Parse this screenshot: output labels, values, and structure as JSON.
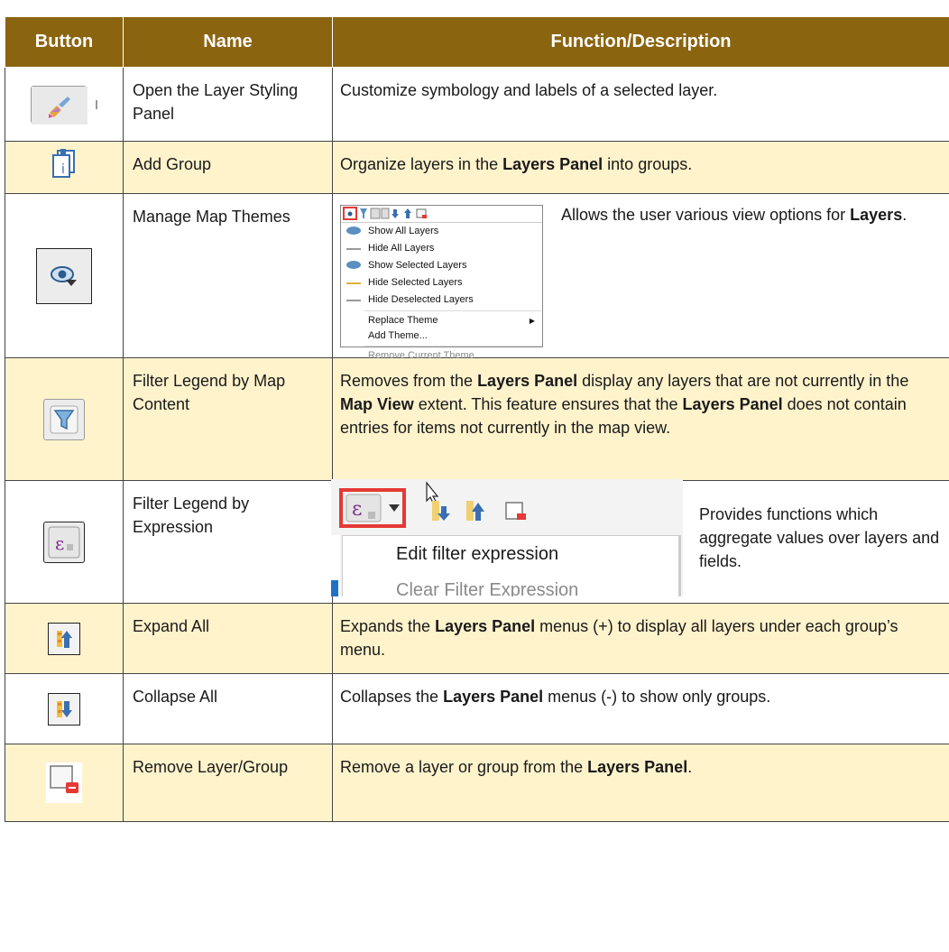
{
  "table": {
    "headers": [
      "Button",
      "Name",
      "Function/Description"
    ],
    "rows": [
      {
        "icon": "layer-styling-icon",
        "name": "Open the Layer Styling Panel",
        "description": "Customize symbology and labels of a selected layer."
      },
      {
        "icon": "add-group-icon",
        "name": "Add Group",
        "description_parts": [
          "Organize layers in the ",
          "Layers Panel",
          " into groups."
        ]
      },
      {
        "icon": "map-themes-icon",
        "name": "Manage Map Themes",
        "description_parts": [
          "Allows the user various view options for ",
          "Layers",
          "."
        ],
        "menu_items": [
          "Show All Layers",
          "Hide All Layers",
          "Show Selected Layers",
          "Hide Selected Layers",
          "Hide Deselected Layers",
          "Replace Theme",
          "Add Theme...",
          "Remove Current Theme"
        ]
      },
      {
        "icon": "filter-legend-icon",
        "name": "Filter Legend by Map Content",
        "description_parts": [
          "Removes from the ",
          "Layers Panel",
          " display any layers that are not currently in the ",
          "Map View",
          " extent. This feature ensures that the ",
          "Layers Panel",
          " does not contain entries for items not currently in the map view."
        ]
      },
      {
        "icon": "filter-expression-icon",
        "name": "Filter Legend by Expression",
        "description": "Provides functions which aggregate values over layers and fields.",
        "menu_items": [
          "Edit filter expression",
          "Clear Filter Expression"
        ]
      },
      {
        "icon": "expand-all-icon",
        "name": "Expand All",
        "description_parts": [
          "Expands the ",
          "Layers Panel",
          " menus (+) to display all layers under each group’s menu."
        ]
      },
      {
        "icon": "collapse-all-icon",
        "name": "Collapse All",
        "description_parts": [
          "Collapses the ",
          "Layers Panel",
          " menus (-) to show only groups."
        ]
      },
      {
        "icon": "remove-layer-icon",
        "name": "Remove Layer/Group",
        "description_parts": [
          "Remove a layer or group from the ",
          "Layers Panel",
          "."
        ]
      }
    ]
  },
  "colors": {
    "header_bg": "#8b6410",
    "alt_row_bg": "#fff3cc",
    "highlight_red": "#e53935"
  }
}
